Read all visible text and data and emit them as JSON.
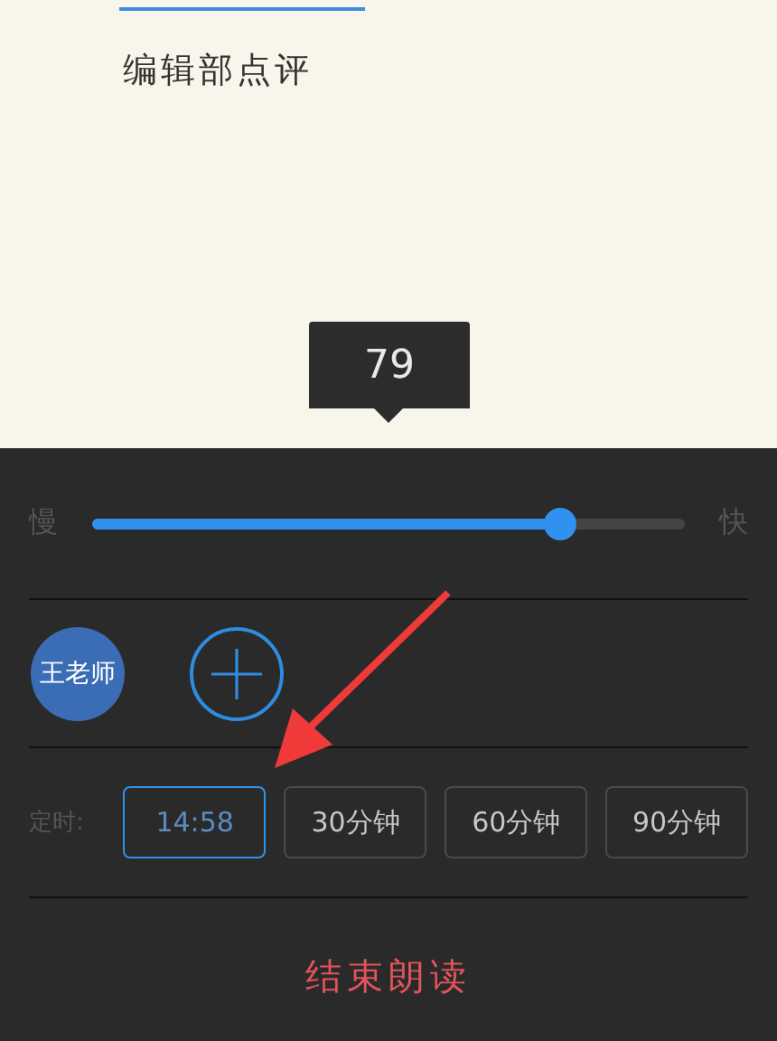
{
  "article": {
    "section_title": "编辑部点评"
  },
  "speed": {
    "value_bubble": "79",
    "slow_label": "慢",
    "fast_label": "快",
    "level": 0.79
  },
  "voices": [
    {
      "name": "王老师",
      "selected": true
    }
  ],
  "timer": {
    "label": "定时:",
    "options": [
      {
        "label": "14:58",
        "selected": true
      },
      {
        "label": "30分钟",
        "selected": false
      },
      {
        "label": "60分钟",
        "selected": false
      },
      {
        "label": "90分钟",
        "selected": false
      }
    ]
  },
  "stop_button": "结束朗读"
}
